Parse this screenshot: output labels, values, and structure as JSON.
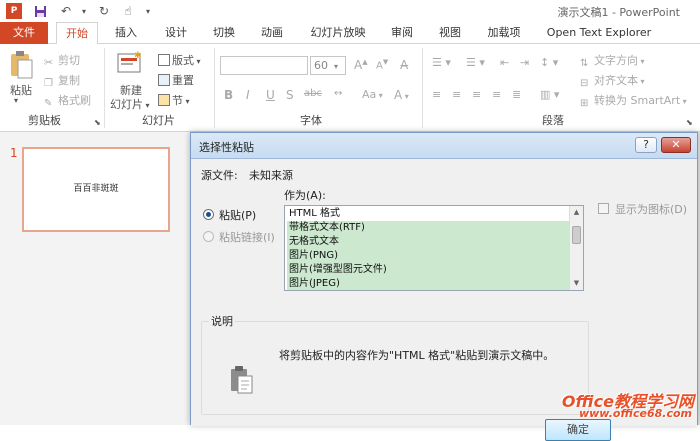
{
  "window": {
    "title": "演示文稿1 - PowerPoint"
  },
  "tabs": [
    "文件",
    "开始",
    "插入",
    "设计",
    "切换",
    "动画",
    "幻灯片放映",
    "审阅",
    "视图",
    "加载项",
    "Open Text Explorer"
  ],
  "active_tab": "开始",
  "ribbon": {
    "clipboard": {
      "paste": "粘贴",
      "cut": "剪切",
      "copy": "复制",
      "format_painter": "格式刷",
      "label": "剪贴板"
    },
    "slides": {
      "new_slide_line1": "新建",
      "new_slide_line2": "幻灯片",
      "layout": "版式",
      "reset": "重置",
      "section": "节",
      "label": "幻灯片"
    },
    "font": {
      "font_name": "",
      "font_size": "60",
      "label": "字体",
      "bold": "B",
      "italic": "I",
      "underline": "U",
      "strike": "S",
      "shadow": "abc",
      "case": "Aa",
      "color": "A"
    },
    "paragraph": {
      "text_direction": "文字方向",
      "align_text": "对齐文本",
      "convert_smartart": "转换为 SmartArt",
      "label": "段落"
    }
  },
  "slide_panel": {
    "slide_number": "1",
    "thumb_text": "百百非斑斑"
  },
  "dialog": {
    "title": "选择性粘贴",
    "help": "?",
    "close": "✕",
    "source_label": "源文件:",
    "source_value": "未知来源",
    "as_label": "作为(A):",
    "paste_option": "粘贴(P)",
    "paste_link_option": "粘贴链接(I)",
    "list_items": [
      "HTML 格式",
      "带格式文本(RTF)",
      "无格式文本",
      "图片(PNG)",
      "图片(增强型图元文件)",
      "图片(JPEG)"
    ],
    "selected_index": 0,
    "display_as_icon": "显示为图标(D)",
    "description_label": "说明",
    "description_text": "将剪贴板中的内容作为\"HTML 格式\"粘贴到演示文稿中。",
    "ok": "确定"
  },
  "watermark": {
    "line1": "Office教程学习网",
    "line2": "www.office68.com"
  },
  "colors": {
    "accent": "#d24726",
    "list_highlight": "#cce8cf"
  }
}
